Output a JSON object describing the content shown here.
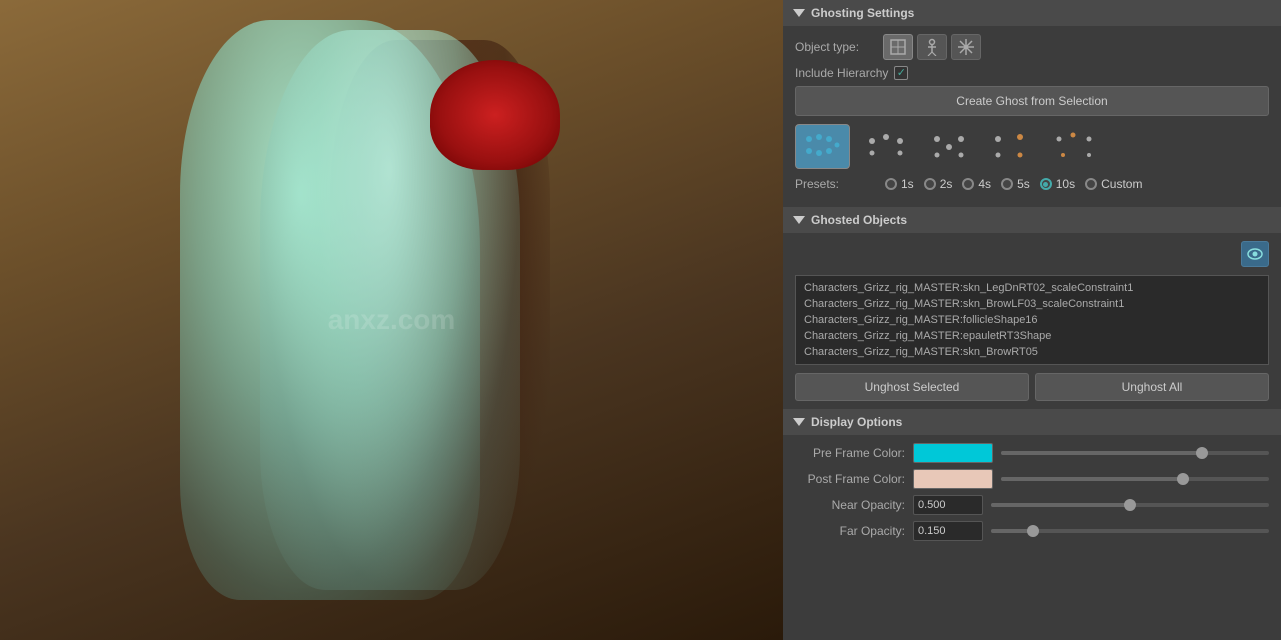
{
  "viewport": {
    "watermark": "anxz.com"
  },
  "panel": {
    "ghosting_settings": {
      "title": "Ghosting Settings",
      "object_type_label": "Object type:",
      "include_hierarchy_label": "Include Hierarchy",
      "create_button": "Create Ghost from Selection",
      "presets_label": "Presets:",
      "preset_options": [
        {
          "label": "1s",
          "value": "1s",
          "selected": false
        },
        {
          "label": "2s",
          "value": "2s",
          "selected": false
        },
        {
          "label": "4s",
          "value": "4s",
          "selected": false
        },
        {
          "label": "5s",
          "value": "5s",
          "selected": false
        },
        {
          "label": "10s",
          "value": "10s",
          "selected": true
        },
        {
          "label": "Custom",
          "value": "Custom",
          "selected": false
        }
      ]
    },
    "ghosted_objects": {
      "title": "Ghosted Objects",
      "items": [
        "Characters_Grizz_rig_MASTER:skn_LegDnRT02_scaleConstraint1",
        "Characters_Grizz_rig_MASTER:skn_BrowLF03_scaleConstraint1",
        "Characters_Grizz_rig_MASTER:follicleShape16",
        "Characters_Grizz_rig_MASTER:epauletRT3Shape",
        "Characters_Grizz_rig_MASTER:skn_BrowRT05"
      ],
      "unghost_selected": "Unghost Selected",
      "unghost_all": "Unghost All"
    },
    "display_options": {
      "title": "Display Options",
      "pre_frame_color_label": "Pre Frame Color:",
      "pre_frame_color": "#00c8d8",
      "post_frame_color_label": "Post Frame Color:",
      "post_frame_color": "#e8c8b8",
      "near_opacity_label": "Near Opacity:",
      "near_opacity_value": "0.500",
      "near_opacity_percent": 50,
      "far_opacity_label": "Far Opacity:",
      "far_opacity_value": "0.150",
      "far_opacity_percent": 15
    }
  }
}
